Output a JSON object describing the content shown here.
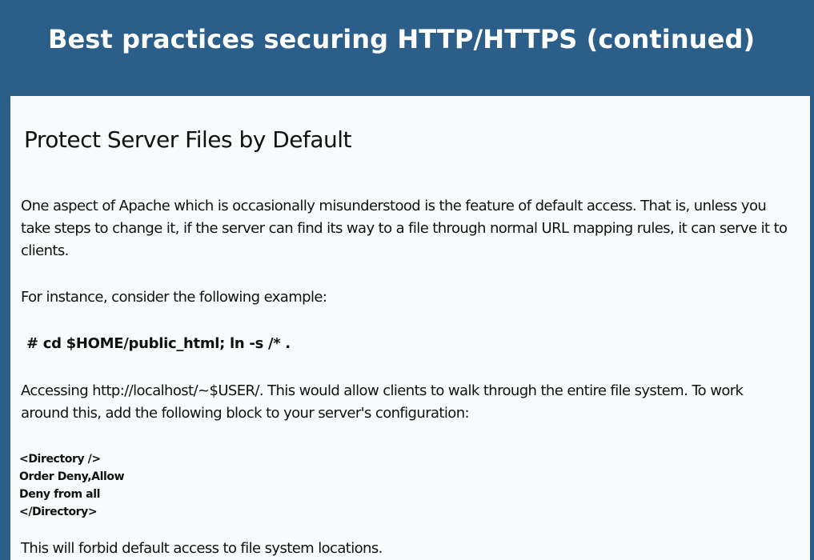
{
  "header": {
    "title": "Best practices securing HTTP/HTTPS (continued)"
  },
  "content": {
    "heading": "Protect Server Files by Default",
    "paragraph_1": "One aspect of Apache which is occasionally misunderstood is the feature of default access. That is, unless you take steps to change it, if the server can find its way to a file through normal URL mapping rules, it can serve it to clients.",
    "paragraph_2": "For instance, consider the following example:",
    "command": "# cd $HOME/public_html; ln -s /* .",
    "paragraph_3": "Accessing http://localhost/~$USER/.  This would allow clients to walk through the entire file system. To work around this, add the following block to your server's configuration:",
    "config_lines": [
      "<Directory />",
      "Order Deny,Allow",
      "Deny from all",
      "</Directory>"
    ],
    "paragraph_4": "This will forbid default access to file system locations."
  },
  "colors": {
    "header_background": "#2b5f8a",
    "panel_background": "#f7fbfb",
    "title_text": "#ffffff",
    "body_text": "#111111"
  }
}
